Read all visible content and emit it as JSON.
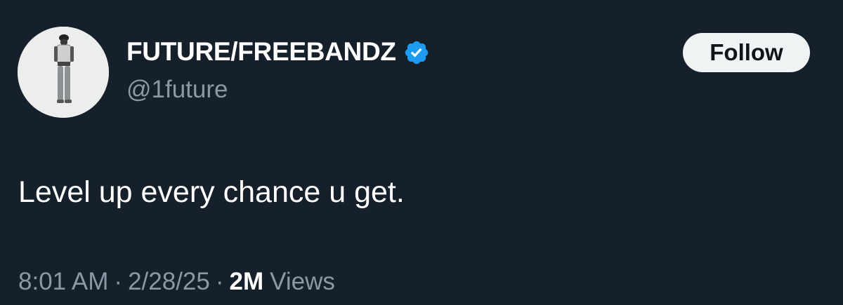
{
  "author": {
    "display_name": "FUTURE/FREEBANDZ",
    "handle": "@1future",
    "verified": true,
    "avatar_icon": "avatar-photo"
  },
  "follow_button": {
    "label": "Follow"
  },
  "tweet": {
    "text": "Level up every chance u get."
  },
  "meta": {
    "time": "8:01 AM",
    "separator": "·",
    "date": "2/28/25",
    "views_count": "2M",
    "views_label": "Views"
  },
  "colors": {
    "background": "#15202b",
    "verified_blue": "#1d9bf0",
    "secondary_text": "#8b98a5",
    "primary_text": "#ffffff",
    "button_bg": "#eff3f4"
  }
}
